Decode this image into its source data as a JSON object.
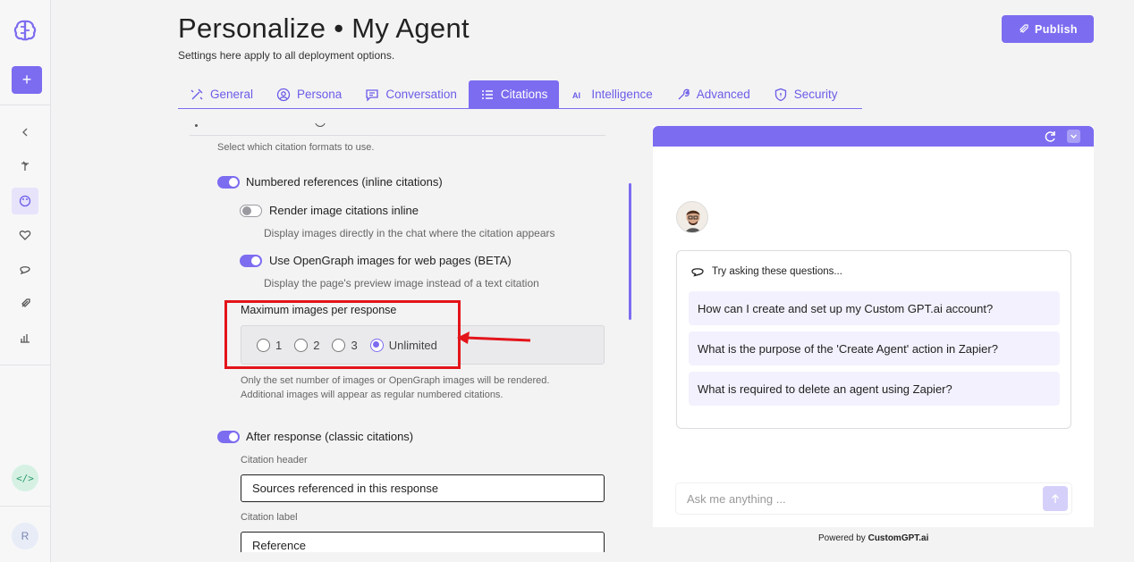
{
  "header": {
    "title": "Personalize • My Agent",
    "subtitle": "Settings here apply to all deployment options.",
    "publish_label": "Publish"
  },
  "tabs": [
    {
      "label": "General",
      "icon": "magic-icon"
    },
    {
      "label": "Persona",
      "icon": "user-circle-icon"
    },
    {
      "label": "Conversation",
      "icon": "chat-icon"
    },
    {
      "label": "Citations",
      "icon": "citations-icon",
      "active": true
    },
    {
      "label": "Intelligence",
      "icon": "ai-icon"
    },
    {
      "label": "Advanced",
      "icon": "wrench-icon"
    },
    {
      "label": "Security",
      "icon": "shield-icon"
    }
  ],
  "citations": {
    "formats_desc": "Select which citation formats to use.",
    "numbered": {
      "label": "Numbered references (inline citations)",
      "enabled": true
    },
    "render_inline": {
      "label": "Render image citations inline",
      "desc": "Display images directly in the chat where the citation appears",
      "enabled": false
    },
    "opengraph": {
      "label": "Use OpenGraph images for web pages (BETA)",
      "desc": "Display the page's preview image instead of a text citation",
      "enabled": true
    },
    "max_images": {
      "label": "Maximum images per response",
      "options": [
        "1",
        "2",
        "3",
        "Unlimited"
      ],
      "selected": "Unlimited",
      "note_line1": "Only the set number of images or OpenGraph images will be rendered.",
      "note_line2": "Additional images will appear as regular numbered citations."
    },
    "after_response": {
      "label": "After response (classic citations)",
      "enabled": true
    },
    "citation_header": {
      "label": "Citation header",
      "value": "Sources referenced in this response"
    },
    "citation_label": {
      "label": "Citation label",
      "value": "Reference"
    }
  },
  "preview": {
    "questions_heading": "Try asking these questions...",
    "questions": [
      "How can I create and set up my Custom GPT.ai account?",
      "What is the purpose of the 'Create Agent' action in Zapier?",
      "What is required to delete an agent using Zapier?"
    ],
    "input_placeholder": "Ask me anything ...",
    "powered_prefix": "Powered by",
    "powered_brand": "CustomGPT.ai"
  },
  "sidebar": {
    "user_initial": "R",
    "code_label": "</>"
  },
  "colors": {
    "accent": "#7c6cf0",
    "highlight": "#e3141a"
  }
}
